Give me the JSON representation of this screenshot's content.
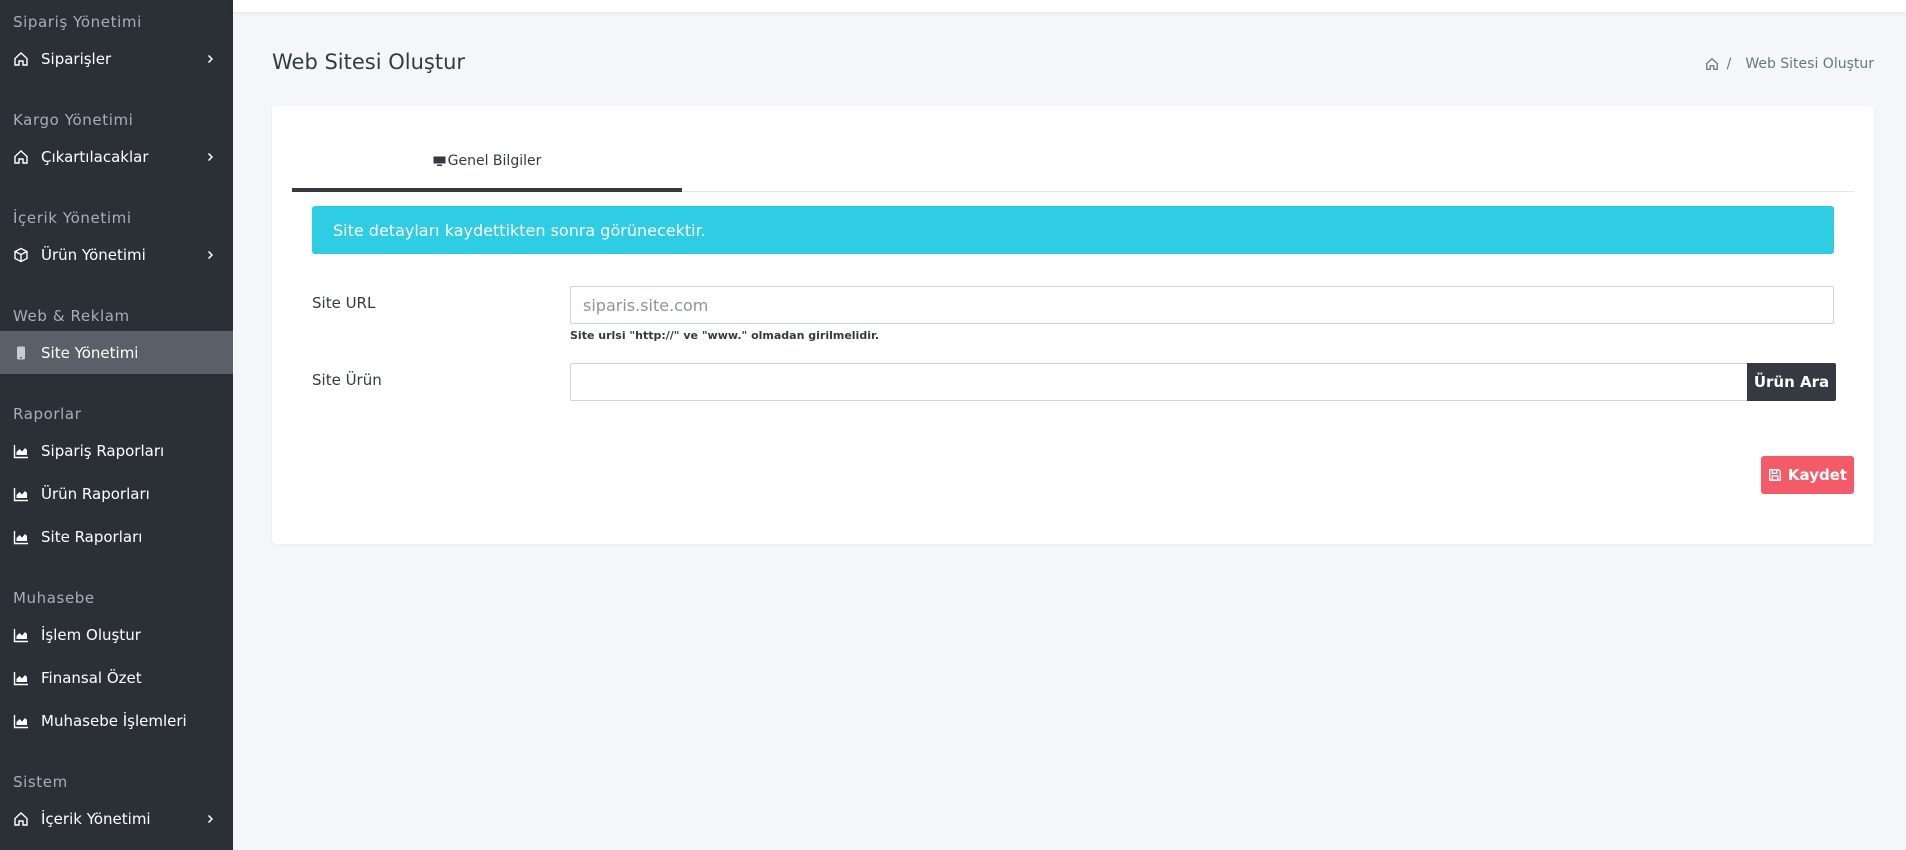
{
  "sidebar": {
    "sections": [
      {
        "heading": "Sipariş Yönetimi",
        "items": [
          {
            "label": "Siparişler",
            "icon": "home-icon",
            "chevron": true
          }
        ]
      },
      {
        "heading": "Kargo Yönetimi",
        "items": [
          {
            "label": "Çıkartılacaklar",
            "icon": "home-icon",
            "chevron": true
          }
        ]
      },
      {
        "heading": "İçerik Yönetimi",
        "items": [
          {
            "label": "Ürün Yönetimi",
            "icon": "cube-icon",
            "chevron": true
          }
        ]
      },
      {
        "heading": "Web & Reklam",
        "items": [
          {
            "label": "Site Yönetimi",
            "icon": "mobile-icon",
            "active": true
          }
        ]
      },
      {
        "heading": "Raporlar",
        "items": [
          {
            "label": "Sipariş Raporları",
            "icon": "area-chart-icon"
          },
          {
            "label": "Ürün Raporları",
            "icon": "area-chart-icon"
          },
          {
            "label": "Site Raporları",
            "icon": "area-chart-icon"
          }
        ]
      },
      {
        "heading": "Muhasebe",
        "items": [
          {
            "label": "İşlem Oluştur",
            "icon": "area-chart-icon"
          },
          {
            "label": "Finansal Özet",
            "icon": "area-chart-icon"
          },
          {
            "label": "Muhasebe İşlemleri",
            "icon": "area-chart-icon"
          }
        ]
      },
      {
        "heading": "Sistem",
        "items": [
          {
            "label": "İçerik Yönetimi",
            "icon": "home-icon",
            "chevron": true
          }
        ]
      }
    ]
  },
  "page": {
    "title": "Web Sitesi Oluştur",
    "breadcrumb_separator": "/",
    "breadcrumb_current": "Web Sitesi Oluştur"
  },
  "tabs": {
    "general_label": "Genel Bilgiler"
  },
  "alert": {
    "text": "Site detayları kaydettikten sonra görünecektir."
  },
  "form": {
    "site_url_label": "Site URL",
    "site_url_placeholder": "siparis.site.com",
    "site_url_value": "",
    "site_url_help": "Site urlsi \"http://\" ve \"www.\" olmadan girilmelidir.",
    "site_urun_label": "Site Ürün",
    "site_urun_value": "",
    "urun_ara_label": "Ürün Ara",
    "save_label": "Kaydet"
  },
  "colors": {
    "sidebar_bg": "#2a3035",
    "active_item_bg": "#5a6067",
    "alert_bg": "#2ecde3",
    "save_bg": "#f45b69",
    "dark_button_bg": "#343a40"
  }
}
